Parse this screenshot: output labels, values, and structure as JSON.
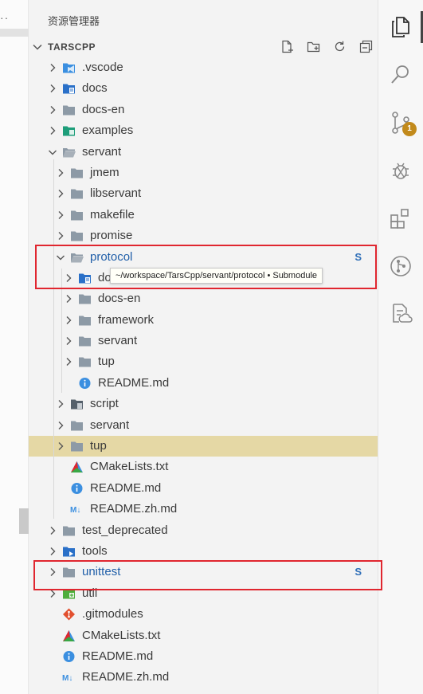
{
  "explorer": {
    "title": "资源管理器",
    "section_title": "TARSCPP"
  },
  "tooltip": "~/workspace/TarsCpp/servant/protocol • Submodule",
  "activity": {
    "scm_badge": "1"
  },
  "tree": [
    {
      "label": ".vscode",
      "depth": 0,
      "twisty": "right",
      "icon": "vscode-folder-icon",
      "color": "#3b8fe0"
    },
    {
      "label": "docs",
      "depth": 0,
      "twisty": "right",
      "icon": "docs-folder-icon",
      "color": "#2a70c8"
    },
    {
      "label": "docs-en",
      "depth": 0,
      "twisty": "right",
      "icon": "folder-icon",
      "color": "#8d9aa6"
    },
    {
      "label": "examples",
      "depth": 0,
      "twisty": "right",
      "icon": "examples-folder-icon",
      "color": "#1e9e7a"
    },
    {
      "label": "servant",
      "depth": 0,
      "twisty": "down",
      "icon": "folder-open-icon",
      "color": "#8d9aa6"
    },
    {
      "label": "jmem",
      "depth": 1,
      "twisty": "right",
      "icon": "folder-icon",
      "color": "#8d9aa6"
    },
    {
      "label": "libservant",
      "depth": 1,
      "twisty": "right",
      "icon": "folder-icon",
      "color": "#8d9aa6"
    },
    {
      "label": "makefile",
      "depth": 1,
      "twisty": "right",
      "icon": "folder-icon",
      "color": "#8d9aa6"
    },
    {
      "label": "promise",
      "depth": 1,
      "twisty": "right",
      "icon": "folder-icon",
      "color": "#8d9aa6"
    },
    {
      "label": "protocol",
      "depth": 1,
      "twisty": "down",
      "icon": "folder-open-icon",
      "color": "#8d9aa6",
      "blue": true,
      "badge": "S"
    },
    {
      "label": "docs",
      "depth": 2,
      "twisty": "right",
      "icon": "docs-folder-icon",
      "color": "#2a70c8"
    },
    {
      "label": "docs-en",
      "depth": 2,
      "twisty": "right",
      "icon": "folder-icon",
      "color": "#8d9aa6"
    },
    {
      "label": "framework",
      "depth": 2,
      "twisty": "right",
      "icon": "folder-icon",
      "color": "#8d9aa6"
    },
    {
      "label": "servant",
      "depth": 2,
      "twisty": "right",
      "icon": "folder-icon",
      "color": "#8d9aa6"
    },
    {
      "label": "tup",
      "depth": 2,
      "twisty": "right",
      "icon": "folder-icon",
      "color": "#8d9aa6"
    },
    {
      "label": "README.md",
      "depth": 2,
      "twisty": "none",
      "icon": "info-icon",
      "color": "#3b8fe0"
    },
    {
      "label": "script",
      "depth": 1,
      "twisty": "right",
      "icon": "script-folder-icon",
      "color": "#55606b"
    },
    {
      "label": "servant",
      "depth": 1,
      "twisty": "right",
      "icon": "folder-icon",
      "color": "#8d9aa6"
    },
    {
      "label": "tup",
      "depth": 1,
      "twisty": "right",
      "icon": "folder-icon",
      "color": "#8d9aa6",
      "selected": true
    },
    {
      "label": "CMakeLists.txt",
      "depth": 1,
      "twisty": "none",
      "icon": "cmake-icon",
      "color": "#3b8fe0"
    },
    {
      "label": "README.md",
      "depth": 1,
      "twisty": "none",
      "icon": "info-icon",
      "color": "#3b8fe0"
    },
    {
      "label": "README.zh.md",
      "depth": 1,
      "twisty": "none",
      "icon": "markdown-icon",
      "color": "#3b8fe0"
    },
    {
      "label": "test_deprecated",
      "depth": 0,
      "twisty": "right",
      "icon": "folder-icon",
      "color": "#8d9aa6"
    },
    {
      "label": "tools",
      "depth": 0,
      "twisty": "right",
      "icon": "tools-folder-icon",
      "color": "#2a70c8"
    },
    {
      "label": "unittest",
      "depth": 0,
      "twisty": "right",
      "icon": "folder-icon",
      "color": "#8d9aa6",
      "blue": true,
      "badge": "S"
    },
    {
      "label": "util",
      "depth": 0,
      "twisty": "right",
      "icon": "util-folder-icon",
      "color": "#4fae3c"
    },
    {
      "label": ".gitmodules",
      "depth": 0,
      "twisty": "none",
      "icon": "git-icon",
      "color": "#e2502f"
    },
    {
      "label": "CMakeLists.txt",
      "depth": 0,
      "twisty": "none",
      "icon": "cmake-icon",
      "color": "#3b8fe0"
    },
    {
      "label": "README.md",
      "depth": 0,
      "twisty": "none",
      "icon": "info-icon",
      "color": "#3b8fe0"
    },
    {
      "label": "README.zh.md",
      "depth": 0,
      "twisty": "none",
      "icon": "markdown-icon",
      "color": "#3b8fe0"
    }
  ]
}
